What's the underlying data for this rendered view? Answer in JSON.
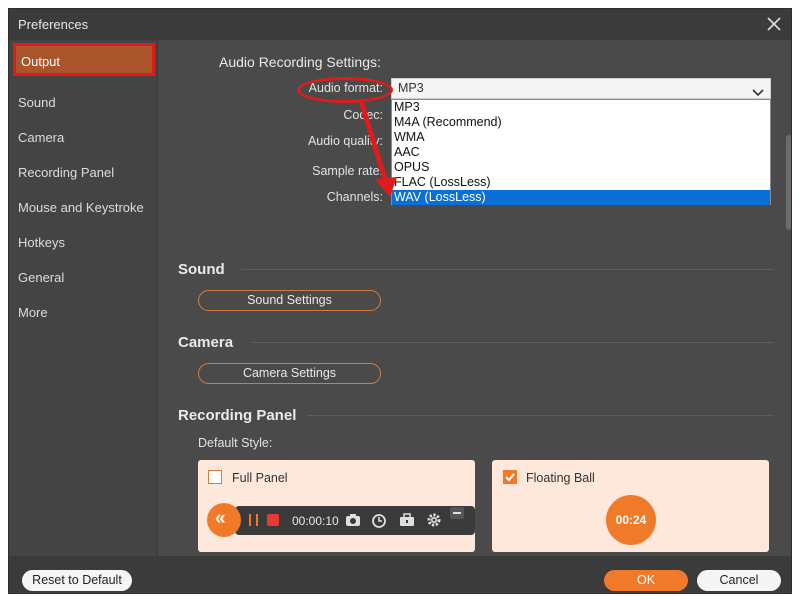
{
  "window": {
    "title": "Preferences"
  },
  "sidebar": {
    "items": [
      {
        "label": "Output",
        "active": true
      },
      {
        "label": "Sound"
      },
      {
        "label": "Camera"
      },
      {
        "label": "Recording Panel"
      },
      {
        "label": "Mouse and Keystroke"
      },
      {
        "label": "Hotkeys"
      },
      {
        "label": "General"
      },
      {
        "label": "More"
      }
    ]
  },
  "audio": {
    "heading": "Audio Recording Settings:",
    "labels": {
      "format": "Audio format:",
      "codec": "Codec:",
      "quality": "Audio quality:",
      "sample_rate": "Sample rate:",
      "channels": "Channels:"
    },
    "format_value": "MP3",
    "format_options": [
      "MP3",
      "M4A (Recommend)",
      "WMA",
      "AAC",
      "OPUS",
      "FLAC (LossLess)",
      "WAV (LossLess)"
    ],
    "highlighted_option": "WAV (LossLess)"
  },
  "sound": {
    "heading": "Sound",
    "button": "Sound Settings"
  },
  "camera": {
    "heading": "Camera",
    "button": "Camera Settings"
  },
  "recording_panel": {
    "heading": "Recording Panel",
    "default_style_label": "Default Style:",
    "full_panel": {
      "label": "Full Panel",
      "checked": false
    },
    "floating_ball": {
      "label": "Floating Ball",
      "checked": true
    },
    "timer": "00:00:10",
    "ball_timer": "00:24"
  },
  "footer": {
    "reset": "Reset to Default",
    "ok": "OK",
    "cancel": "Cancel"
  },
  "colors": {
    "accent": "#f07a2a",
    "annotation_red": "#e01b1b",
    "dropdown_highlight": "#0a6fd6",
    "background": "#4a4a4a"
  },
  "icons": [
    "close-icon",
    "chevron-down-icon",
    "pause-icon",
    "record-stop-icon",
    "camera-icon",
    "clock-icon",
    "toolbox-icon",
    "gear-icon",
    "minimize-icon",
    "double-left-chevron-icon",
    "checkmark-icon",
    "annotation-arrow"
  ]
}
